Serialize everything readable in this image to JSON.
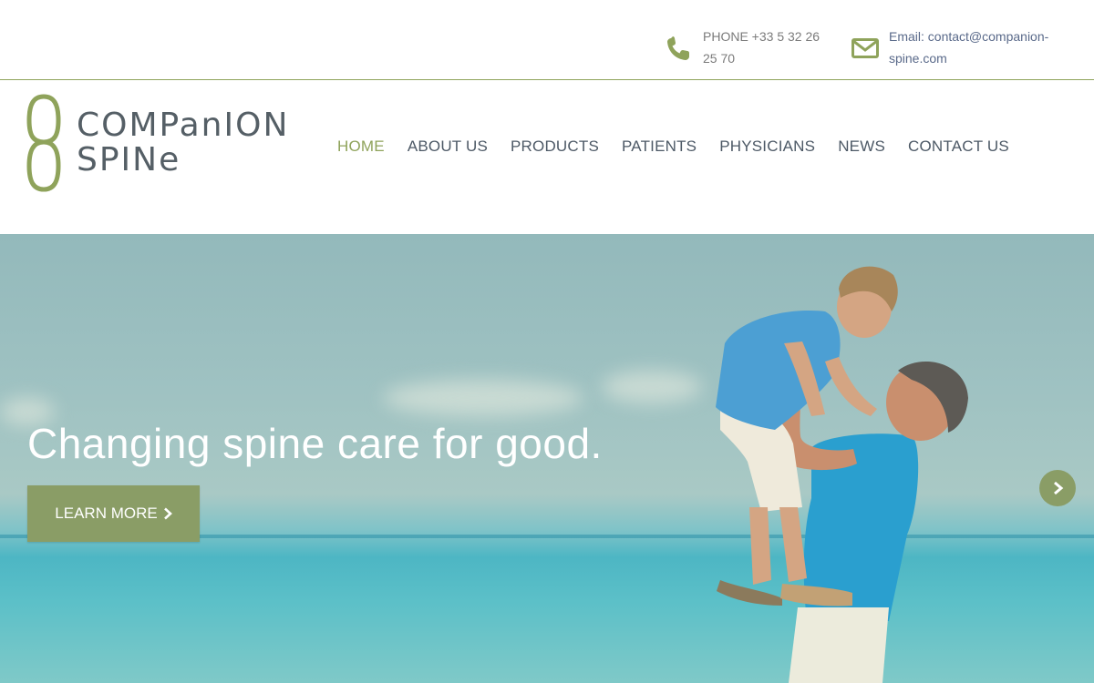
{
  "colors": {
    "brand_green": "#8fa35b",
    "button_green": "#8a9d66",
    "nav_text": "#4d5966",
    "hero_text": "#ffffff"
  },
  "contact": {
    "phone": {
      "icon": "phone-icon",
      "text": "PHONE +33 5 32 26 25 70"
    },
    "email": {
      "icon": "envelope-icon",
      "text": "Email: contact@companion-spine.com"
    }
  },
  "logo": {
    "icon": "logo-mark",
    "line1": "COMPanION",
    "line2": "SPINe"
  },
  "nav": {
    "items": [
      {
        "label": "HOME",
        "active": true
      },
      {
        "label": "ABOUT US"
      },
      {
        "label": "PRODUCTS"
      },
      {
        "label": "PATIENTS"
      },
      {
        "label": "PHYSICIANS"
      },
      {
        "label": "NEWS"
      },
      {
        "label": "CONTACT US"
      }
    ]
  },
  "hero": {
    "title": "Changing spine care for good.",
    "button_label": "LEARN MORE",
    "button_icon": "chevron-right-icon",
    "next_icon": "chevron-right-icon"
  }
}
